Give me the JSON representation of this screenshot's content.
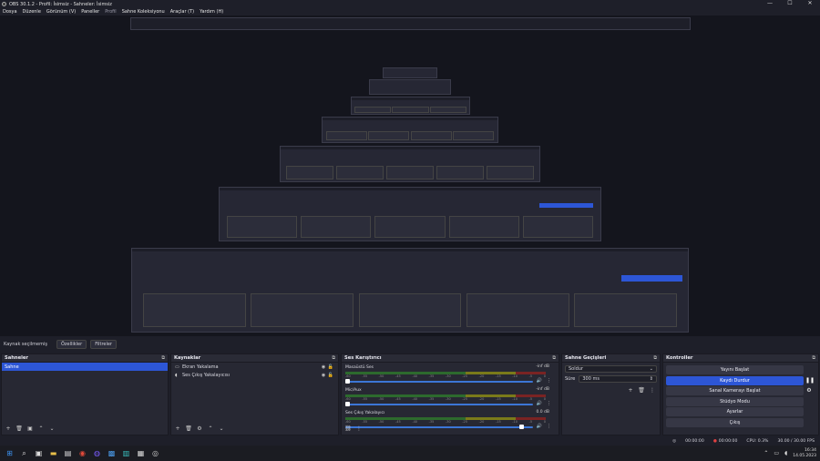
{
  "window": {
    "title": "OBS 30.1.2 - Profil: İsimsiz - Sahneler: İsimsiz",
    "min": "—",
    "max": "☐",
    "close": "✕"
  },
  "menu": [
    {
      "label": "Dosya",
      "dim": false
    },
    {
      "label": "Düzenle",
      "dim": false
    },
    {
      "label": "Görünüm (V)",
      "dim": false
    },
    {
      "label": "Paneller",
      "dim": false
    },
    {
      "label": "Profil",
      "dim": true
    },
    {
      "label": "Sahne Koleksiyonu",
      "dim": false
    },
    {
      "label": "Araçlar (T)",
      "dim": false
    },
    {
      "label": "Yardım (H)",
      "dim": false
    }
  ],
  "scene_bar": {
    "label": "Kaynak seçilmemiş",
    "properties": "Özellikler",
    "filters": "Filtreler"
  },
  "scenes": {
    "title": "Sahneler",
    "items": [
      "Sahne"
    ]
  },
  "sources": {
    "title": "Kaynaklar",
    "items": [
      "Ekran Yakalama",
      "Ses Çıkış Yakalayıcısı"
    ]
  },
  "mixer": {
    "title": "Ses Karıştırıcı",
    "channels": [
      {
        "name": "Masaüstü Ses",
        "db": "-inf dB",
        "level": 0.0
      },
      {
        "name": "Mic/Aux",
        "db": "-inf dB",
        "level": 0.0
      },
      {
        "name": "Ses Çıkış Yakalayıcı",
        "db": "0.0 dB",
        "level": 1.0
      }
    ],
    "ticks": [
      "-60",
      "-55",
      "-50",
      "-45",
      "-40",
      "-35",
      "-30",
      "-25",
      "-20",
      "-15",
      "-10",
      "-5",
      "0"
    ]
  },
  "transitions": {
    "title": "Sahne Geçişleri",
    "selected": "Soldur",
    "duration_label": "Süre",
    "duration": "300 ms"
  },
  "controls": {
    "title": "Kontroller",
    "buttons": [
      "Yayını Başlat",
      "Kaydı Durdur",
      "Sanal Kamerayı Başlat",
      "Stüdyo Modu",
      "Ayarlar",
      "Çıkış"
    ]
  },
  "status": {
    "rec_time": "00:00:00",
    "stream_time": "00:00:00",
    "cpu": "CPU: 0.3%",
    "fps": "30.00 / 30.00 FPS"
  },
  "clock": {
    "time": "16:34",
    "date": "14.05.2023"
  },
  "colors": {
    "accent": "#2d56d6",
    "bg": "#1e1f29",
    "panel": "#272833"
  }
}
